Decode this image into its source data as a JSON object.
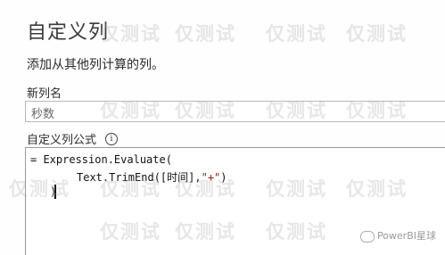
{
  "dialog": {
    "title": "自定义列",
    "description": "添加从其他列计算的列。",
    "name_label": "新列名",
    "name_value": "秒数",
    "formula_label": "自定义列公式",
    "info_glyph": "i",
    "formula": {
      "line1": "= Expression.Evaluate(",
      "line2_pre": "Text.TrimEnd([时间],",
      "line2_str": "\"+\"",
      "line2_post": ")",
      "line3": ")"
    }
  },
  "watermark": {
    "text": "仅测试",
    "color": "#aaaaaa"
  },
  "logo": {
    "text": "PowerBI星球"
  }
}
